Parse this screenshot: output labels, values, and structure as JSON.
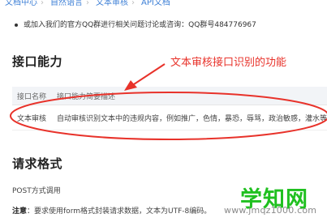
{
  "breadcrumb": {
    "items": [
      "文档中心",
      "自然语言",
      "文本审核",
      "API文档"
    ]
  },
  "intro": {
    "text": "或加入我们的官方QQ群进行相关问题讨论或咨询：QQ群号484776967"
  },
  "sections": {
    "api_capability": "接口能力",
    "request_format": "请求格式"
  },
  "annotation": {
    "text": "文本审核接口识别的功能",
    "color": "#e8322a"
  },
  "table": {
    "headers": [
      "接口名称",
      "接口能力简要描述"
    ],
    "rows": [
      [
        "文本审核",
        "自动审核识别文本中的违规内容，例如推广，色情，暴恐，辱骂，政治敏感，灌水等"
      ]
    ]
  },
  "request": {
    "method_text": "POST方式调用",
    "note_label": "注意",
    "note_text": "：要求使用form格式封装请求数据，文本为UTF-8编码。"
  },
  "watermark": {
    "brand": "学知网",
    "url": "www.jmqz1000.com",
    "brand_color": "#20c020"
  },
  "colors": {
    "link": "#3d7fd6",
    "table_header_bg": "#f2f4f7"
  }
}
